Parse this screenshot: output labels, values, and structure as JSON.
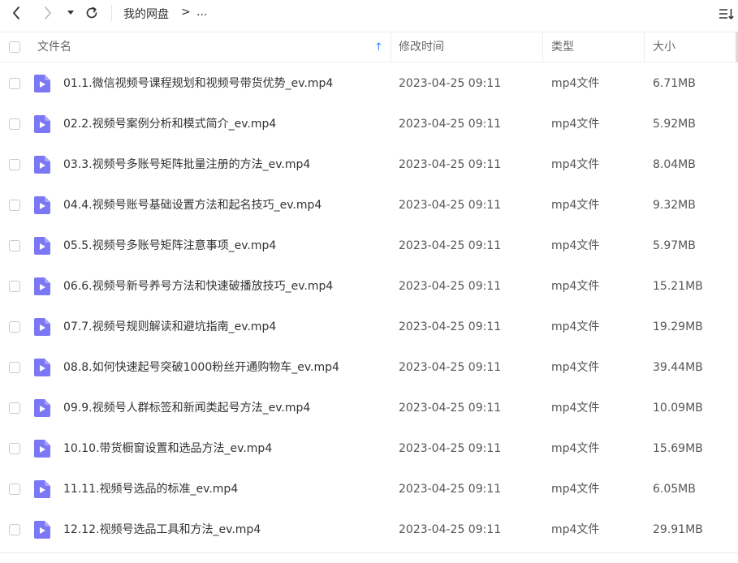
{
  "toolbar": {
    "back": "back-icon",
    "forward": "forward-icon",
    "dropdown": "caret-down-icon",
    "refresh": "refresh-icon",
    "menu": "list-sort-icon"
  },
  "breadcrumb": {
    "root": "我的网盘",
    "separator": ">",
    "more": "..."
  },
  "columns": {
    "name": "文件名",
    "modified": "修改时间",
    "type": "类型",
    "size": "大小",
    "sort_arrow": "↑"
  },
  "colors": {
    "file_icon": "#7b77f5",
    "sort_arrow": "#2f8cf5",
    "text": "#333333"
  },
  "files": [
    {
      "name": "01.1.微信视频号课程规划和视频号带货优势_ev.mp4",
      "modified": "2023-04-25 09:11",
      "type": "mp4文件",
      "size": "6.71MB"
    },
    {
      "name": "02.2.视频号案例分析和模式简介_ev.mp4",
      "modified": "2023-04-25 09:11",
      "type": "mp4文件",
      "size": "5.92MB"
    },
    {
      "name": "03.3.视频号多账号矩阵批量注册的方法_ev.mp4",
      "modified": "2023-04-25 09:11",
      "type": "mp4文件",
      "size": "8.04MB"
    },
    {
      "name": "04.4.视频号账号基础设置方法和起名技巧_ev.mp4",
      "modified": "2023-04-25 09:11",
      "type": "mp4文件",
      "size": "9.32MB"
    },
    {
      "name": "05.5.视频号多账号矩阵注意事项_ev.mp4",
      "modified": "2023-04-25 09:11",
      "type": "mp4文件",
      "size": "5.97MB"
    },
    {
      "name": "06.6.视频号新号养号方法和快速破播放技巧_ev.mp4",
      "modified": "2023-04-25 09:11",
      "type": "mp4文件",
      "size": "15.21MB"
    },
    {
      "name": "07.7.视频号规则解读和避坑指南_ev.mp4",
      "modified": "2023-04-25 09:11",
      "type": "mp4文件",
      "size": "19.29MB"
    },
    {
      "name": "08.8.如何快速起号突破1000粉丝开通购物车_ev.mp4",
      "modified": "2023-04-25 09:11",
      "type": "mp4文件",
      "size": "39.44MB"
    },
    {
      "name": "09.9.视频号人群标签和新闻类起号方法_ev.mp4",
      "modified": "2023-04-25 09:11",
      "type": "mp4文件",
      "size": "10.09MB"
    },
    {
      "name": "10.10.带货橱窗设置和选品方法_ev.mp4",
      "modified": "2023-04-25 09:11",
      "type": "mp4文件",
      "size": "15.69MB"
    },
    {
      "name": "11.11.视频号选品的标准_ev.mp4",
      "modified": "2023-04-25 09:11",
      "type": "mp4文件",
      "size": "6.05MB"
    },
    {
      "name": "12.12.视频号选品工具和方法_ev.mp4",
      "modified": "2023-04-25 09:11",
      "type": "mp4文件",
      "size": "29.91MB"
    }
  ]
}
